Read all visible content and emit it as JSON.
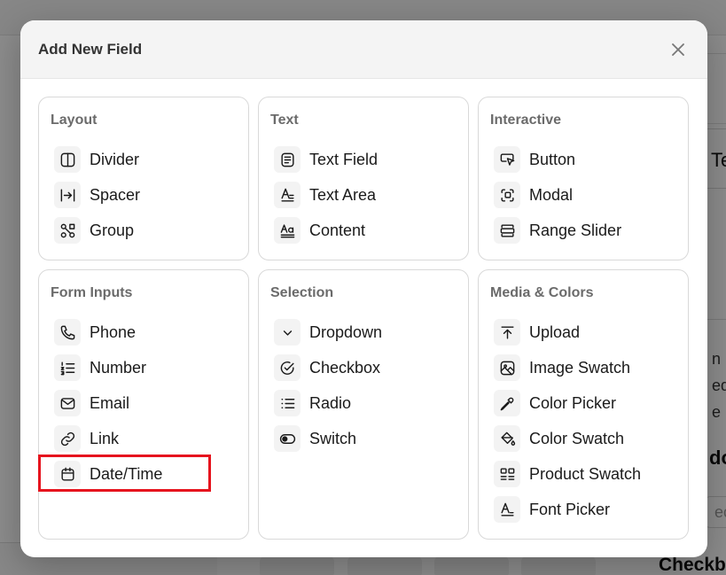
{
  "background": {
    "right_text_1": "Te",
    "right_text_2": "do",
    "right_text_3": "Checkb",
    "right_line_1": "n ip",
    "right_line_2": "ed",
    "right_line_3": "e m",
    "input_placeholder": "ect"
  },
  "modal": {
    "title": "Add New Field",
    "close_icon": "close-icon",
    "sections": [
      {
        "title": "Layout",
        "items": [
          {
            "label": "Divider",
            "icon": "columns-icon"
          },
          {
            "label": "Spacer",
            "icon": "spacer-icon"
          },
          {
            "label": "Group",
            "icon": "group-icon"
          }
        ]
      },
      {
        "title": "Text",
        "items": [
          {
            "label": "Text Field",
            "icon": "text-lines-icon"
          },
          {
            "label": "Text Area",
            "icon": "text-area-icon"
          },
          {
            "label": "Content",
            "icon": "content-icon"
          }
        ]
      },
      {
        "title": "Interactive",
        "items": [
          {
            "label": "Button",
            "icon": "cursor-click-icon"
          },
          {
            "label": "Modal",
            "icon": "modal-icon"
          },
          {
            "label": "Range Slider",
            "icon": "slider-icon"
          }
        ]
      },
      {
        "title": "Form Inputs",
        "items": [
          {
            "label": "Phone",
            "icon": "phone-icon"
          },
          {
            "label": "Number",
            "icon": "numbered-list-icon"
          },
          {
            "label": "Email",
            "icon": "mail-icon"
          },
          {
            "label": "Link",
            "icon": "link-icon"
          },
          {
            "label": "Date/Time",
            "icon": "calendar-icon"
          }
        ]
      },
      {
        "title": "Selection",
        "items": [
          {
            "label": "Dropdown",
            "icon": "chevron-down-icon"
          },
          {
            "label": "Checkbox",
            "icon": "check-circle-icon"
          },
          {
            "label": "Radio",
            "icon": "list-icon"
          },
          {
            "label": "Switch",
            "icon": "toggle-icon"
          }
        ]
      },
      {
        "title": "Media & Colors",
        "items": [
          {
            "label": "Upload",
            "icon": "upload-icon"
          },
          {
            "label": "Image Swatch",
            "icon": "image-swatch-icon"
          },
          {
            "label": "Color Picker",
            "icon": "eyedropper-icon"
          },
          {
            "label": "Color Swatch",
            "icon": "paint-bucket-icon"
          },
          {
            "label": "Product Swatch",
            "icon": "product-swatch-icon"
          },
          {
            "label": "Font Picker",
            "icon": "font-icon"
          }
        ]
      }
    ]
  },
  "colors": {
    "highlight": "#e6141e",
    "card_border": "#d9d9d9",
    "header_bg": "#f4f4f4",
    "section_title": "#6b6b6b"
  }
}
